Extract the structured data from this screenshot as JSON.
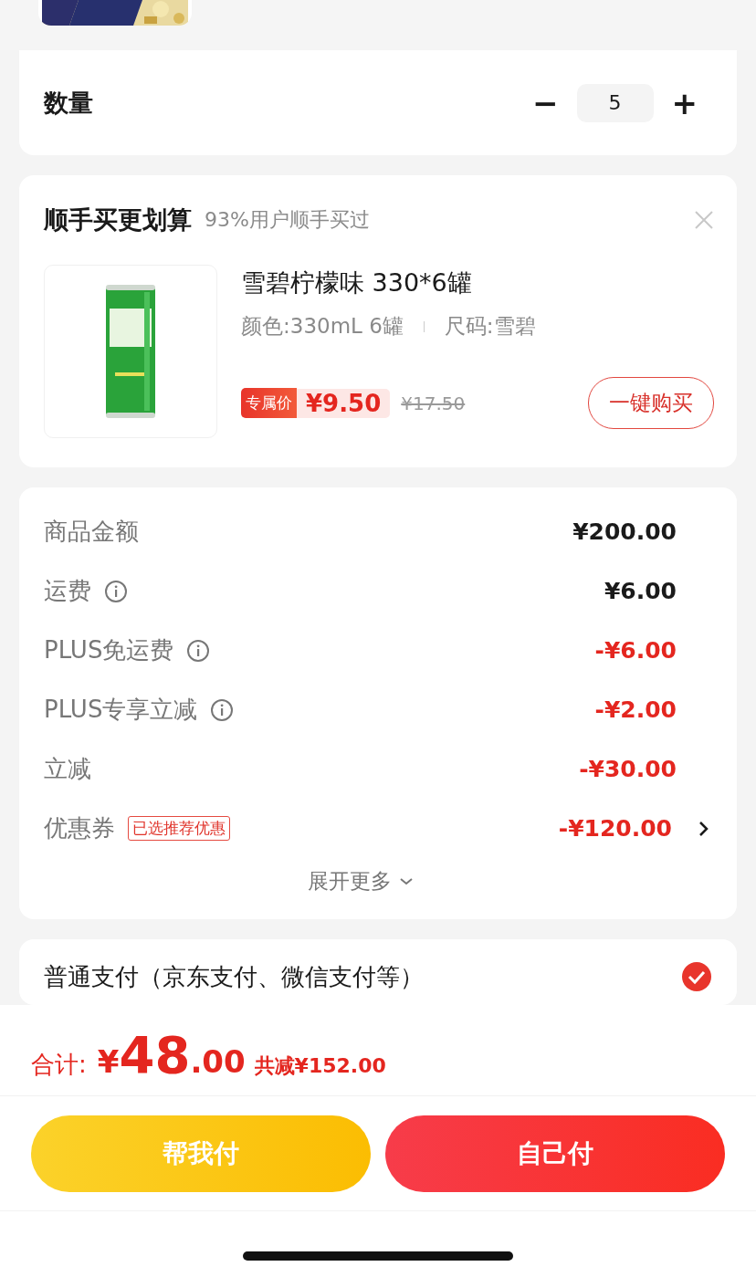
{
  "quantity": {
    "label": "数量",
    "minus": "−",
    "value": "5",
    "plus": "+"
  },
  "upsell": {
    "title": "顺手买更划算",
    "subtitle": "93%用户顺手买过",
    "product": {
      "name": "雪碧柠檬味 330*6罐",
      "spec_1": "颜色:330mL 6罐",
      "spec_2": "尺码:雪碧",
      "price_tag": "专属价",
      "price": "¥9.50",
      "original_price": "¥17.50",
      "button": "一键购买"
    }
  },
  "summary": {
    "rows": [
      {
        "label": "商品金额",
        "info": false,
        "value": "¥200.00",
        "kind": "normal"
      },
      {
        "label": "运费",
        "info": true,
        "value": "¥6.00",
        "kind": "normal"
      },
      {
        "label": "PLUS免运费",
        "info": true,
        "value": "-¥6.00",
        "kind": "discount"
      },
      {
        "label": "PLUS专享立减",
        "info": true,
        "value": "-¥2.00",
        "kind": "discount"
      },
      {
        "label": "立减",
        "info": false,
        "value": "-¥30.00",
        "kind": "discount"
      },
      {
        "label": "优惠券",
        "info": false,
        "tag": "已选推荐优惠",
        "value": "-¥120.00",
        "kind": "discount",
        "chevron": true
      }
    ],
    "expand": "展开更多"
  },
  "payment": {
    "label": "普通支付（京东支付、微信支付等）",
    "checked": true
  },
  "total": {
    "label": "合计:",
    "currency": "¥",
    "integer": "48",
    "decimal": ".00",
    "saved": "共减¥152.00"
  },
  "buttons": [
    {
      "label": "帮我付",
      "kind": "yellow"
    },
    {
      "label": "自己付",
      "kind": "red"
    }
  ]
}
